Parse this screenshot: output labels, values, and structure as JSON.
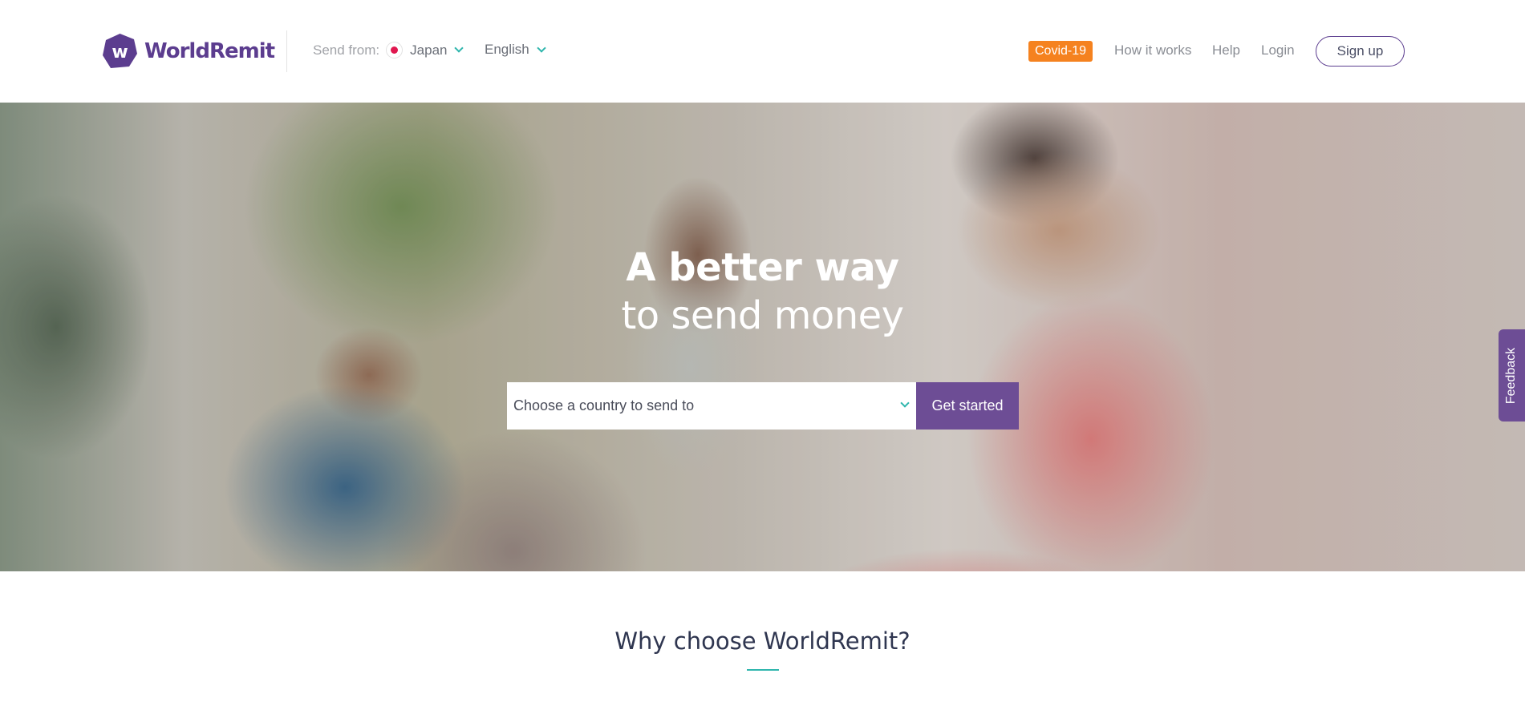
{
  "header": {
    "brand": "WorldRemit",
    "logo_letter": "w",
    "send_from_label": "Send from:",
    "send_from_country": "Japan",
    "language": "English",
    "covid_label": "Covid-19",
    "nav_how_it_works": "How it works",
    "nav_help": "Help",
    "nav_login": "Login",
    "signup_label": "Sign up"
  },
  "hero": {
    "title": "A better way",
    "subtitle": "to send money",
    "country_placeholder": "Choose a country to send to",
    "cta_label": "Get started"
  },
  "feedback": {
    "label": "Feedback"
  },
  "why": {
    "title": "Why choose WorldRemit?"
  },
  "colors": {
    "brand_purple": "#5c3d8f",
    "button_purple": "#6d4d95",
    "covid_orange": "#f5821f",
    "accent_teal": "#2fb6ad",
    "japan_flag_red": "#e0174f"
  },
  "icons": [
    "worldremit-logo-icon",
    "japan-flag-icon",
    "chevron-down-icon"
  ]
}
